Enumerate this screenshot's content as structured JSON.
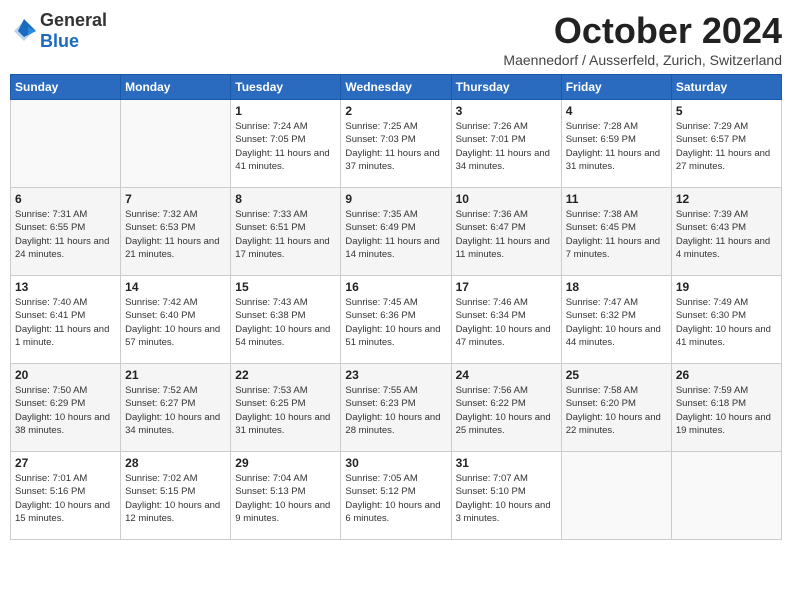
{
  "header": {
    "logo_general": "General",
    "logo_blue": "Blue",
    "month_title": "October 2024",
    "location": "Maennedorf / Ausserfeld, Zurich, Switzerland"
  },
  "weekdays": [
    "Sunday",
    "Monday",
    "Tuesday",
    "Wednesday",
    "Thursday",
    "Friday",
    "Saturday"
  ],
  "weeks": [
    [
      {
        "day": "",
        "info": ""
      },
      {
        "day": "",
        "info": ""
      },
      {
        "day": "1",
        "info": "Sunrise: 7:24 AM\nSunset: 7:05 PM\nDaylight: 11 hours and 41 minutes."
      },
      {
        "day": "2",
        "info": "Sunrise: 7:25 AM\nSunset: 7:03 PM\nDaylight: 11 hours and 37 minutes."
      },
      {
        "day": "3",
        "info": "Sunrise: 7:26 AM\nSunset: 7:01 PM\nDaylight: 11 hours and 34 minutes."
      },
      {
        "day": "4",
        "info": "Sunrise: 7:28 AM\nSunset: 6:59 PM\nDaylight: 11 hours and 31 minutes."
      },
      {
        "day": "5",
        "info": "Sunrise: 7:29 AM\nSunset: 6:57 PM\nDaylight: 11 hours and 27 minutes."
      }
    ],
    [
      {
        "day": "6",
        "info": "Sunrise: 7:31 AM\nSunset: 6:55 PM\nDaylight: 11 hours and 24 minutes."
      },
      {
        "day": "7",
        "info": "Sunrise: 7:32 AM\nSunset: 6:53 PM\nDaylight: 11 hours and 21 minutes."
      },
      {
        "day": "8",
        "info": "Sunrise: 7:33 AM\nSunset: 6:51 PM\nDaylight: 11 hours and 17 minutes."
      },
      {
        "day": "9",
        "info": "Sunrise: 7:35 AM\nSunset: 6:49 PM\nDaylight: 11 hours and 14 minutes."
      },
      {
        "day": "10",
        "info": "Sunrise: 7:36 AM\nSunset: 6:47 PM\nDaylight: 11 hours and 11 minutes."
      },
      {
        "day": "11",
        "info": "Sunrise: 7:38 AM\nSunset: 6:45 PM\nDaylight: 11 hours and 7 minutes."
      },
      {
        "day": "12",
        "info": "Sunrise: 7:39 AM\nSunset: 6:43 PM\nDaylight: 11 hours and 4 minutes."
      }
    ],
    [
      {
        "day": "13",
        "info": "Sunrise: 7:40 AM\nSunset: 6:41 PM\nDaylight: 11 hours and 1 minute."
      },
      {
        "day": "14",
        "info": "Sunrise: 7:42 AM\nSunset: 6:40 PM\nDaylight: 10 hours and 57 minutes."
      },
      {
        "day": "15",
        "info": "Sunrise: 7:43 AM\nSunset: 6:38 PM\nDaylight: 10 hours and 54 minutes."
      },
      {
        "day": "16",
        "info": "Sunrise: 7:45 AM\nSunset: 6:36 PM\nDaylight: 10 hours and 51 minutes."
      },
      {
        "day": "17",
        "info": "Sunrise: 7:46 AM\nSunset: 6:34 PM\nDaylight: 10 hours and 47 minutes."
      },
      {
        "day": "18",
        "info": "Sunrise: 7:47 AM\nSunset: 6:32 PM\nDaylight: 10 hours and 44 minutes."
      },
      {
        "day": "19",
        "info": "Sunrise: 7:49 AM\nSunset: 6:30 PM\nDaylight: 10 hours and 41 minutes."
      }
    ],
    [
      {
        "day": "20",
        "info": "Sunrise: 7:50 AM\nSunset: 6:29 PM\nDaylight: 10 hours and 38 minutes."
      },
      {
        "day": "21",
        "info": "Sunrise: 7:52 AM\nSunset: 6:27 PM\nDaylight: 10 hours and 34 minutes."
      },
      {
        "day": "22",
        "info": "Sunrise: 7:53 AM\nSunset: 6:25 PM\nDaylight: 10 hours and 31 minutes."
      },
      {
        "day": "23",
        "info": "Sunrise: 7:55 AM\nSunset: 6:23 PM\nDaylight: 10 hours and 28 minutes."
      },
      {
        "day": "24",
        "info": "Sunrise: 7:56 AM\nSunset: 6:22 PM\nDaylight: 10 hours and 25 minutes."
      },
      {
        "day": "25",
        "info": "Sunrise: 7:58 AM\nSunset: 6:20 PM\nDaylight: 10 hours and 22 minutes."
      },
      {
        "day": "26",
        "info": "Sunrise: 7:59 AM\nSunset: 6:18 PM\nDaylight: 10 hours and 19 minutes."
      }
    ],
    [
      {
        "day": "27",
        "info": "Sunrise: 7:01 AM\nSunset: 5:16 PM\nDaylight: 10 hours and 15 minutes."
      },
      {
        "day": "28",
        "info": "Sunrise: 7:02 AM\nSunset: 5:15 PM\nDaylight: 10 hours and 12 minutes."
      },
      {
        "day": "29",
        "info": "Sunrise: 7:04 AM\nSunset: 5:13 PM\nDaylight: 10 hours and 9 minutes."
      },
      {
        "day": "30",
        "info": "Sunrise: 7:05 AM\nSunset: 5:12 PM\nDaylight: 10 hours and 6 minutes."
      },
      {
        "day": "31",
        "info": "Sunrise: 7:07 AM\nSunset: 5:10 PM\nDaylight: 10 hours and 3 minutes."
      },
      {
        "day": "",
        "info": ""
      },
      {
        "day": "",
        "info": ""
      }
    ]
  ]
}
